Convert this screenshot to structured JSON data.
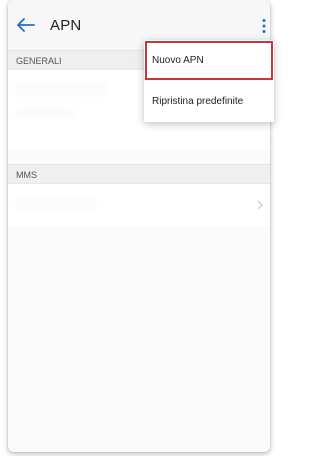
{
  "appbar": {
    "title": "APN"
  },
  "sections": [
    {
      "header": "GENERALI"
    },
    {
      "header": "MMS"
    }
  ],
  "menu": {
    "items": [
      {
        "label": "Nuovo APN",
        "highlighted": true
      },
      {
        "label": "Ripristina predefinite",
        "highlighted": false
      }
    ]
  },
  "colors": {
    "highlight_border": "#c9353a",
    "back_arrow": "#1f6fd1"
  }
}
